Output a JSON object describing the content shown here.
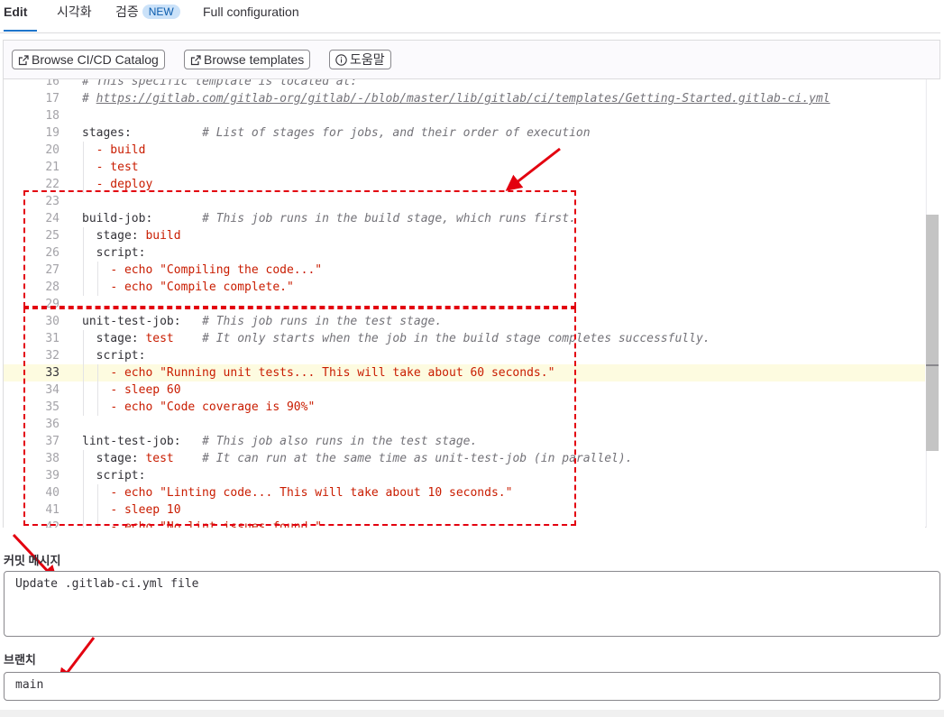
{
  "tabs": [
    {
      "label": "Edit",
      "active": true
    },
    {
      "label": "시각화"
    },
    {
      "label": "검증",
      "badge": "NEW"
    },
    {
      "label": "Full configuration"
    }
  ],
  "toolbar": {
    "browse_catalog": "Browse CI/CD Catalog",
    "browse_templates": "Browse templates",
    "help": "도움말"
  },
  "code_lines": [
    {
      "n": "16",
      "parts": [
        [
          "com",
          "# This specific template is located at:"
        ]
      ]
    },
    {
      "n": "17",
      "parts": [
        [
          "com",
          "# "
        ],
        [
          "link",
          "https://gitlab.com/gitlab-org/gitlab/-/blob/master/lib/gitlab/ci/templates/Getting-Started.gitlab-ci.yml"
        ]
      ]
    },
    {
      "n": "18",
      "parts": []
    },
    {
      "n": "19",
      "parts": [
        [
          "key",
          "stages:"
        ],
        [
          "key",
          "          "
        ],
        [
          "com",
          "# List of stages for jobs, and their order of execution"
        ]
      ]
    },
    {
      "n": "20",
      "indent": 1,
      "parts": [
        [
          "key",
          "  "
        ],
        [
          "val",
          "- build"
        ]
      ]
    },
    {
      "n": "21",
      "indent": 1,
      "parts": [
        [
          "key",
          "  "
        ],
        [
          "val",
          "- test"
        ]
      ]
    },
    {
      "n": "22",
      "indent": 1,
      "parts": [
        [
          "key",
          "  "
        ],
        [
          "val",
          "- deploy"
        ]
      ]
    },
    {
      "n": "23",
      "parts": []
    },
    {
      "n": "24",
      "parts": [
        [
          "key",
          "build-job:"
        ],
        [
          "key",
          "       "
        ],
        [
          "com",
          "# This job runs in the build stage, which runs first."
        ]
      ]
    },
    {
      "n": "25",
      "indent": 1,
      "parts": [
        [
          "key",
          "  stage: "
        ],
        [
          "val",
          "build"
        ]
      ]
    },
    {
      "n": "26",
      "indent": 1,
      "parts": [
        [
          "key",
          "  script:"
        ]
      ]
    },
    {
      "n": "27",
      "indent": 2,
      "parts": [
        [
          "key",
          "    "
        ],
        [
          "val",
          "- echo \"Compiling the code...\""
        ]
      ]
    },
    {
      "n": "28",
      "indent": 2,
      "parts": [
        [
          "key",
          "    "
        ],
        [
          "val",
          "- echo \"Compile complete.\""
        ]
      ]
    },
    {
      "n": "29",
      "parts": []
    },
    {
      "n": "30",
      "parts": [
        [
          "key",
          "unit-test-job:"
        ],
        [
          "key",
          "   "
        ],
        [
          "com",
          "# This job runs in the test stage."
        ]
      ]
    },
    {
      "n": "31",
      "indent": 1,
      "parts": [
        [
          "key",
          "  stage: "
        ],
        [
          "val",
          "test"
        ],
        [
          "key",
          "    "
        ],
        [
          "com",
          "# It only starts when the job in the build stage completes successfully."
        ]
      ]
    },
    {
      "n": "32",
      "indent": 1,
      "parts": [
        [
          "key",
          "  script:"
        ]
      ]
    },
    {
      "n": "33",
      "indent": 2,
      "current": true,
      "parts": [
        [
          "key",
          "    "
        ],
        [
          "val",
          "- echo \"Running unit tests... This will take about 60 seconds.\""
        ]
      ]
    },
    {
      "n": "34",
      "indent": 2,
      "parts": [
        [
          "key",
          "    "
        ],
        [
          "val",
          "- sleep 60"
        ]
      ]
    },
    {
      "n": "35",
      "indent": 2,
      "parts": [
        [
          "key",
          "    "
        ],
        [
          "val",
          "- echo \"Code coverage is 90%\""
        ]
      ]
    },
    {
      "n": "36",
      "parts": []
    },
    {
      "n": "37",
      "parts": [
        [
          "key",
          "lint-test-job:"
        ],
        [
          "key",
          "   "
        ],
        [
          "com",
          "# This job also runs in the test stage."
        ]
      ]
    },
    {
      "n": "38",
      "indent": 1,
      "parts": [
        [
          "key",
          "  stage: "
        ],
        [
          "val",
          "test"
        ],
        [
          "key",
          "    "
        ],
        [
          "com",
          "# It can run at the same time as unit-test-job (in parallel)."
        ]
      ]
    },
    {
      "n": "39",
      "indent": 1,
      "parts": [
        [
          "key",
          "  script:"
        ]
      ]
    },
    {
      "n": "40",
      "indent": 2,
      "parts": [
        [
          "key",
          "    "
        ],
        [
          "val",
          "- echo \"Linting code... This will take about 10 seconds.\""
        ]
      ]
    },
    {
      "n": "41",
      "indent": 2,
      "parts": [
        [
          "key",
          "    "
        ],
        [
          "val",
          "- sleep 10"
        ]
      ]
    },
    {
      "n": "42",
      "indent": 2,
      "parts": [
        [
          "key",
          "    "
        ],
        [
          "val",
          "- echo \"No lint issues found.\""
        ]
      ]
    }
  ],
  "commit": {
    "label": "커밋 메시지",
    "value": "Update .gitlab-ci.yml file"
  },
  "branch": {
    "label": "브랜치",
    "value": "main"
  },
  "colors": {
    "accent": "#1f75cb",
    "annotation": "#e3000f",
    "string_value": "#c91c00"
  }
}
